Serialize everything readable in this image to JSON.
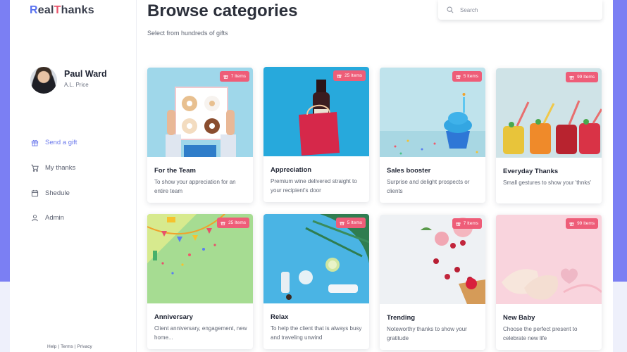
{
  "app": {
    "logo_r": "R",
    "logo_mid": "eal",
    "logo_t": "T",
    "logo_end": "hanks"
  },
  "user": {
    "name": "Paul Ward",
    "role": "A.L. Price"
  },
  "sidebar": {
    "items": [
      {
        "label": "Send a gift",
        "icon": "gift-icon"
      },
      {
        "label": "My thanks",
        "icon": "cart-icon"
      },
      {
        "label": "Shedule",
        "icon": "calendar-icon"
      },
      {
        "label": "Admin",
        "icon": "user-icon"
      }
    ],
    "footer": {
      "help": "Help",
      "sep": "|",
      "terms": "Terms",
      "privacy": "Privacy"
    }
  },
  "header": {
    "title": "Browse categories",
    "subtitle": "Select from hundreds of gifts",
    "search_placeholder": "Search"
  },
  "colors": {
    "accent": "#7b7ff3",
    "badge": "#ee5d78",
    "active_nav": "#6b79ec"
  },
  "cards": [
    {
      "title": "For the Team",
      "desc": "To show your appreciation for an entire team",
      "badge": "7 Items"
    },
    {
      "title": "Appreciation",
      "desc": "Premium wine delivered straight to your recipient's door",
      "badge": "25 Items"
    },
    {
      "title": "Sales booster",
      "desc": "Surprise and delight prospects or clients",
      "badge": "5 Items"
    },
    {
      "title": "Everyday Thanks",
      "desc": "Small gestures to show your 'thnks'",
      "badge": "99 Items"
    },
    {
      "title": "Anniversary",
      "desc": "Client anniversary, engagement, new home...",
      "badge": "25 Items"
    },
    {
      "title": "Relax",
      "desc": "To help the client that is always busy and traveling unwind",
      "badge": "5 Items"
    },
    {
      "title": "Trending",
      "desc": "Noteworthy thanks to show your gratitude",
      "badge": "7 Items"
    },
    {
      "title": "New Baby",
      "desc": "Choose the perfect present to celebrate new life",
      "badge": "99 Items"
    }
  ]
}
